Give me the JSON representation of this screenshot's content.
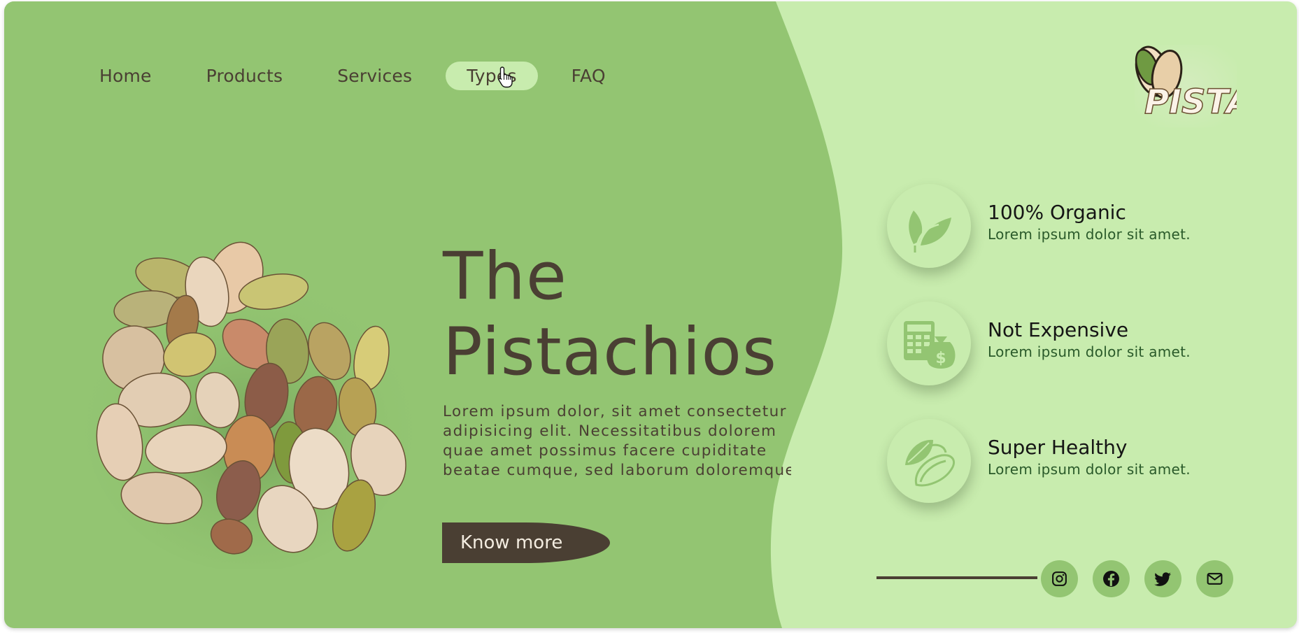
{
  "colors": {
    "dark_green_bg": "#93c572",
    "light_green_bg": "#c8ecae",
    "brown_text": "#4a3f33",
    "feature_subtitle": "#2a5a2a"
  },
  "nav": {
    "items": [
      {
        "label": "Home"
      },
      {
        "label": "Products"
      },
      {
        "label": "Services"
      },
      {
        "label": "Types",
        "active": true
      },
      {
        "label": "FAQ"
      }
    ]
  },
  "logo": {
    "text": "PISTA"
  },
  "hero": {
    "title_line1": "The",
    "title_line2": "Pistachios",
    "description": "Lorem ipsum dolor, sit amet consectetur adipisicing elit. Necessitatibus dolorem quae amet possimus facere cupiditate beatae cumque, sed laborum doloremque",
    "button_label": "Know more"
  },
  "features": [
    {
      "icon": "leaf-icon",
      "title": "100% Organic",
      "subtitle": "Lorem ipsum dolor sit amet."
    },
    {
      "icon": "calculator-money-icon",
      "title": "Not Expensive",
      "subtitle": "Lorem ipsum dolor sit amet."
    },
    {
      "icon": "pistachio-icon",
      "title": "Super Healthy",
      "subtitle": "Lorem ipsum dolor sit amet."
    }
  ],
  "social": [
    {
      "icon": "instagram-icon"
    },
    {
      "icon": "facebook-icon"
    },
    {
      "icon": "twitter-icon"
    },
    {
      "icon": "email-icon"
    }
  ]
}
